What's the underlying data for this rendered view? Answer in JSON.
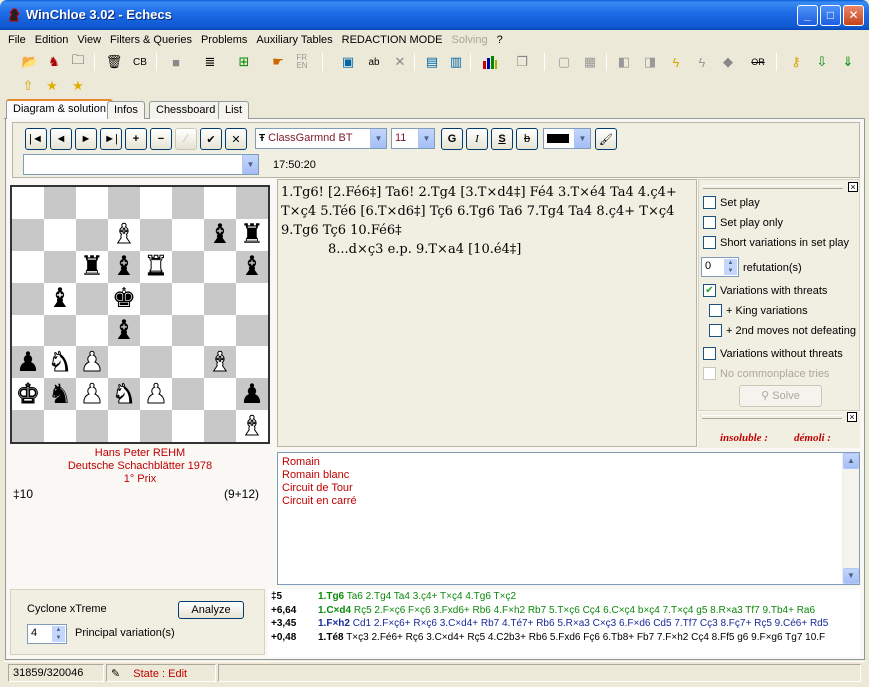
{
  "window": {
    "title": "WinChloe 3.02 - Echecs",
    "min_glyph": "_",
    "max_glyph": "□",
    "close_glyph": "✕"
  },
  "menu": [
    "File",
    "Edition",
    "View",
    "Filters & Queries",
    "Problems",
    "Auxiliary Tables",
    "REDACTION MODE",
    "Solving",
    "?"
  ],
  "tabs": [
    "Diagram & solution",
    "Infos",
    "Chessboard",
    "List"
  ],
  "toolbar_icons": [
    "open-folder-icon",
    "knight-icon",
    "folder-icon",
    "trash-icon",
    "cg-icon",
    "stone-icon",
    "stack-icon",
    "export-icon",
    "hand-icon",
    "fr-en-icon",
    "window-icon",
    "ab-swap-icon",
    "delete-icon",
    "panel-icon",
    "panel2-icon",
    "bar-chart-icon",
    "copy-icon",
    "doc-icon",
    "doc2-icon",
    "arrow-left-icon",
    "arrow-left2-icon",
    "lightning-icon",
    "lightning2-icon",
    "eraser-icon",
    "strike-icon",
    "key-icon",
    "download-icon",
    "download2-icon",
    "upload-icon",
    "star-icon",
    "star2-icon"
  ],
  "toolbar_labels": {
    "fren": "FR\nEN",
    "or": "OR"
  },
  "format": {
    "font": "ClassGarmnd BT",
    "font_icon": "Ŧ",
    "size": "11",
    "bold": "G",
    "italic": "I",
    "underline": "S",
    "strike": "b",
    "nav": [
      "|◄",
      "◄",
      "►",
      "►|",
      "+",
      "−",
      "∕",
      "✔",
      "✕"
    ],
    "time": "17:50:20",
    "combo_value": ""
  },
  "board": [
    [
      "",
      "",
      "",
      "",
      "",
      "",
      "",
      ""
    ],
    [
      "",
      "",
      "",
      "wB",
      "",
      "",
      "bB",
      "bR"
    ],
    [
      "",
      "",
      "bR",
      "bB",
      "wR",
      "",
      "",
      "bB"
    ],
    [
      "",
      "bB",
      "",
      "bK",
      "",
      "",
      "",
      ""
    ],
    [
      "",
      "",
      "",
      "bB",
      "",
      "",
      "",
      ""
    ],
    [
      "bP",
      "wN",
      "wP",
      "",
      "",
      "",
      "wB",
      ""
    ],
    [
      "wK",
      "bN",
      "wP",
      "wN",
      "wP",
      "",
      "",
      "bP"
    ],
    [
      "",
      "",
      "",
      "",
      "",
      "",
      "",
      "wB"
    ]
  ],
  "credits": {
    "author": "Hans Peter REHM",
    "source": "Deutsche Schachblätter 1978",
    "award": "1° Prix"
  },
  "stipulation": "‡10",
  "piece_count": "(9+12)",
  "solution": {
    "line1": "1.Tg6! [2.Fé6‡] Ta6! 2.Tg4 [3.T×d4‡] Fé4 3.T×é4 Ta4 4.ç4+",
    "line2": "T×ç4 5.Té6 [6.T×d6‡] Tç6 6.Tg6 Ta6 7.Tg4 Ta4 8.ç4+ T×ç4",
    "line3": "9.Tg6 Tç6 10.Fé6‡",
    "line4": "8...d×ç3 e.p. 9.T×a4 [10.é4‡]"
  },
  "options": {
    "set_play": "Set play",
    "set_play_only": "Set play only",
    "short_variations": "Short variations in set play",
    "refutations_value": "0",
    "refutations_label": "refutation(s)",
    "variations_threats": "Variations with threats",
    "king_variations": "+ King variations",
    "second_moves": "+ 2nd moves not defeating",
    "variations_without": "Variations without threats",
    "no_commonplace": "No commonplace tries",
    "solve": "Solve",
    "check": "✔"
  },
  "status_labels": {
    "insoluble": "insoluble :",
    "demoli": "démoli :"
  },
  "themes": [
    "Romain",
    "Romain blanc",
    "Circuit de Tour",
    "Circuit en carré"
  ],
  "engine": {
    "name": "Cyclone xTreme",
    "analyze": "Analyze",
    "pv_value": "4",
    "pv_label": "Principal variation(s)"
  },
  "analysis": [
    {
      "score": "‡5",
      "move": "1.Tg6",
      "line": "Ta6 2.Tg4 Ta4 3.ç4+ T×ç4 4.Tg6 T×ç2",
      "color": "green"
    },
    {
      "score": "+6,64",
      "move": "1.C×d4",
      "line": "Rç5 2.F×ç6 F×ç6 3.Fxd6+ Rb6 4.F×h2 Rb7 5.T×ç6 Cç4 6.C×ç4 b×ç4 7.T×ç4 g5 8.R×a3 Tf7 9.Tb4+ Ra6",
      "color": "green"
    },
    {
      "score": "+3,45",
      "move": "1.F×h2",
      "line": "Cd1 2.F×ç6+ R×ç6 3.C×d4+ Rb7 4.Té7+ Rb6 5.R×a3 C×ç3 6.F×d6 Cd5 7.Tf7 Cç3 8.Fç7+ Rç5 9.Cé6+ Rd5",
      "color": "blue"
    },
    {
      "score": "+0,48",
      "move": "1.Té8",
      "line": "T×ç3 2.Fé6+ Rç6 3.C×d4+ Rç5 4.C2b3+ Rb6 5.Fxd6 Fç6 6.Tb8+ Fb7 7.F×h2 Cç4 8.Ff5 g6 9.F×g6 Tg7 10.F",
      "color": "black"
    }
  ],
  "statusbar": {
    "count": "31859/320046",
    "state": "State : Edit",
    "pen_glyph": "✎"
  }
}
